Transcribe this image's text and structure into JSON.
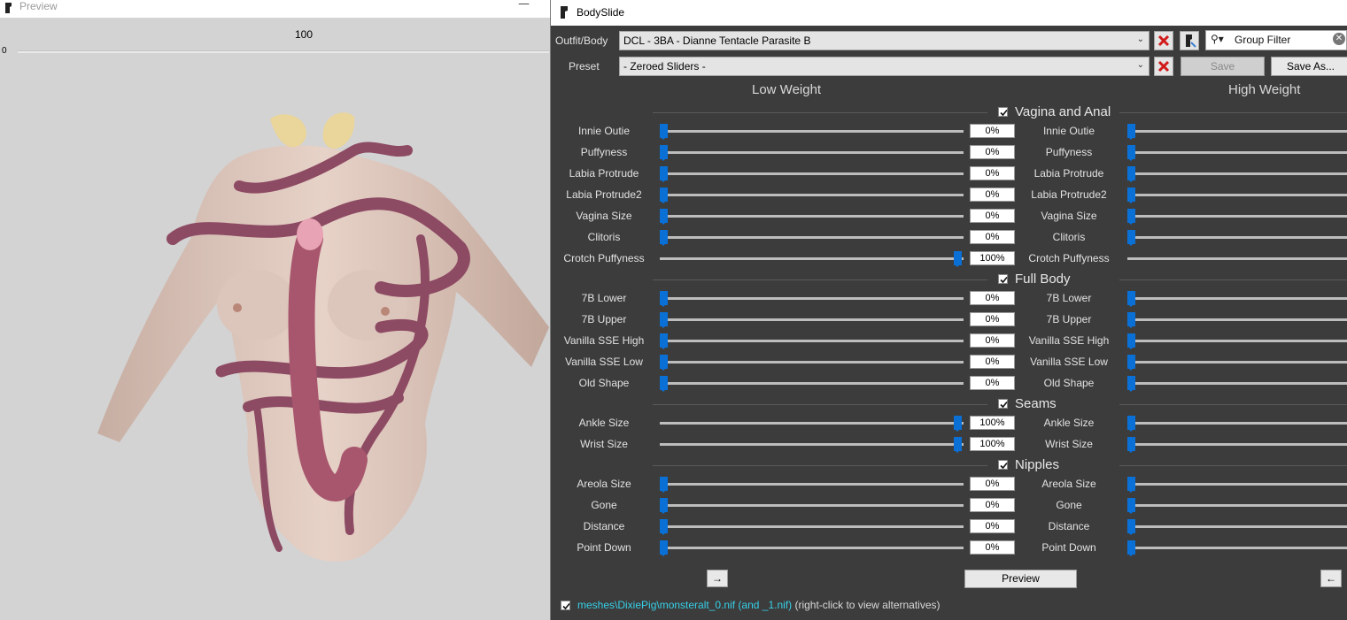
{
  "preview": {
    "title": "Preview",
    "zoom_value": "100",
    "zoom_min": "0"
  },
  "bodyslide": {
    "title": "BodySlide",
    "outfit_label": "Outfit/Body",
    "outfit_value": "DCL - 3BA - Dianne Tentacle Parasite B",
    "preset_label": "Preset",
    "preset_value": "- Zeroed Sliders -",
    "group_filter_placeholder": "Group Filter",
    "save_label": "Save",
    "save_as_label": "Save As...",
    "low_weight_label": "Low Weight",
    "high_weight_label": "High Weight",
    "preview_button": "Preview",
    "arrow_right": "→",
    "arrow_left": "←",
    "mesh_path": "meshes\\DixiePig\\monsteralt_0.nif (and _1.nif)",
    "mesh_hint": "(right-click to view alternatives)",
    "categories": [
      {
        "name": "Vagina and Anal",
        "sliders": [
          {
            "name": "Innie Outie",
            "low": 0,
            "low_text": "0%"
          },
          {
            "name": "Puffyness",
            "low": 0,
            "low_text": "0%"
          },
          {
            "name": "Labia Protrude",
            "low": 0,
            "low_text": "0%"
          },
          {
            "name": "Labia Protrude2",
            "low": 0,
            "low_text": "0%"
          },
          {
            "name": "Vagina Size",
            "low": 0,
            "low_text": "0%"
          },
          {
            "name": "Clitoris",
            "low": 0,
            "low_text": "0%"
          },
          {
            "name": "Crotch Puffyness",
            "low": 100,
            "low_text": "100%"
          }
        ]
      },
      {
        "name": "Full Body",
        "sliders": [
          {
            "name": "7B Lower",
            "low": 0,
            "low_text": "0%"
          },
          {
            "name": "7B Upper",
            "low": 0,
            "low_text": "0%"
          },
          {
            "name": "Vanilla SSE High",
            "low": 0,
            "low_text": "0%"
          },
          {
            "name": "Vanilla SSE Low",
            "low": 0,
            "low_text": "0%"
          },
          {
            "name": "Old Shape",
            "low": 0,
            "low_text": "0%"
          }
        ]
      },
      {
        "name": "Seams",
        "sliders": [
          {
            "name": "Ankle Size",
            "low": 100,
            "low_text": "100%"
          },
          {
            "name": "Wrist Size",
            "low": 100,
            "low_text": "100%"
          }
        ]
      },
      {
        "name": "Nipples",
        "sliders": [
          {
            "name": "Areola Size",
            "low": 0,
            "low_text": "0%"
          },
          {
            "name": "Gone",
            "low": 0,
            "low_text": "0%"
          },
          {
            "name": "Distance",
            "low": 0,
            "low_text": "0%"
          },
          {
            "name": "Point Down",
            "low": 0,
            "low_text": "0%"
          }
        ]
      }
    ]
  }
}
